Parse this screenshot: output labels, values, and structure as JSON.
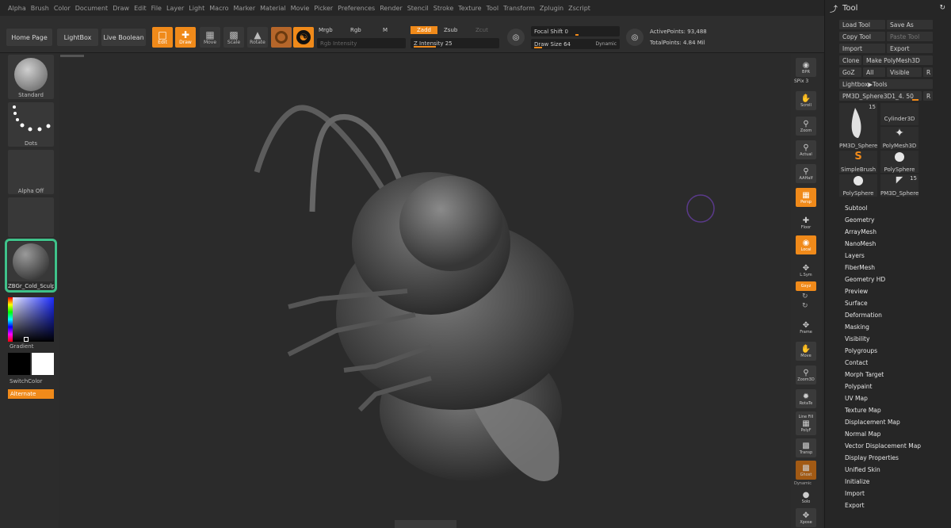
{
  "menu": [
    "Alpha",
    "Brush",
    "Color",
    "Document",
    "Draw",
    "Edit",
    "File",
    "Layer",
    "Light",
    "Macro",
    "Marker",
    "Material",
    "Movie",
    "Picker",
    "Preferences",
    "Render",
    "Stencil",
    "Stroke",
    "Texture",
    "Tool",
    "Transform",
    "Zplugin",
    "Zscript"
  ],
  "shelf": {
    "home_page": "Home Page",
    "lightbox": "LightBox",
    "live_boolean": "Live Boolean",
    "edit": "Edit",
    "draw": "Draw",
    "move": "Move",
    "scale": "Scale",
    "rotate": "Rotate",
    "mrgb": "Mrgb",
    "rgb": "Rgb",
    "m": "M",
    "rgb_intensity": "Rgb Intensity",
    "zadd": "Zadd",
    "zsub": "Zsub",
    "zcut": "Zcut",
    "z_intensity": "Z Intensity 25",
    "z_intensity_value": 25,
    "focal_shift": "Focal Shift 0",
    "draw_size": "Draw Size 64",
    "dynamic": "Dynamic",
    "active_points": "ActivePoints: 93,488",
    "total_points": "TotalPoints: 4.84 Mil"
  },
  "left": {
    "brush_label": "Standard",
    "stroke_label": "Dots",
    "alpha_label": "Alpha Off",
    "material_label": "ZBGr_Cold_Sculp",
    "gradient": "Gradient",
    "switch_color": "SwitchColor",
    "alternate": "Alternate"
  },
  "right": {
    "bpr": "BPR",
    "spix": "SPix 3",
    "scroll": "Scroll",
    "zoom": "Zoom",
    "actual": "Actual",
    "aahalf": "AAHalf",
    "persp": "Persp",
    "floor": "Floor",
    "local": "Local",
    "lsym": "L.Sym",
    "xyz": "Gxyz",
    "frame": "Frame",
    "move": "Move",
    "zoom3d": "Zoom3D",
    "rotate": "RotaTe",
    "line_fill": "Line Fill",
    "polyf": "PolyF",
    "transp": "Transp",
    "ghost": "Ghost",
    "dynamic": "Dynamic",
    "solo": "Solo",
    "xpose": "Xpose"
  },
  "tool": {
    "title": "Tool",
    "load_tool": "Load Tool",
    "save_as": "Save As",
    "copy_tool": "Copy Tool",
    "paste_tool": "Paste Tool",
    "import": "Import",
    "export": "Export",
    "clone": "Clone",
    "make_polymesh": "Make PolyMesh3D",
    "goz": "GoZ",
    "all": "All",
    "visible": "Visible",
    "r": "R",
    "lightbox_tools": "Lightbox▶Tools",
    "current_tool": "PM3D_Sphere3D1_4. 50",
    "tiles": [
      {
        "label": "PM3D_Sphere3D",
        "count": "15"
      },
      {
        "label": "Cylinder3D",
        "count": ""
      },
      {
        "label": "PolyMesh3D",
        "count": ""
      },
      {
        "label": "SimpleBrush",
        "count": ""
      },
      {
        "label": "PolySphere",
        "count": ""
      },
      {
        "label": "PolySphere",
        "count": ""
      },
      {
        "label": "PM3D_Sphere3D",
        "count": "15"
      }
    ],
    "subpalettes": [
      "Subtool",
      "Geometry",
      "ArrayMesh",
      "NanoMesh",
      "Layers",
      "FiberMesh",
      "Geometry HD",
      "Preview",
      "Surface",
      "Deformation",
      "Masking",
      "Visibility",
      "Polygroups",
      "Contact",
      "Morph Target",
      "Polypaint",
      "UV Map",
      "Texture Map",
      "Displacement Map",
      "Normal Map",
      "Vector Displacement Map",
      "Display Properties",
      "Unified Skin",
      "Initialize",
      "Import",
      "Export"
    ]
  },
  "colors": {
    "accent": "#f08a1a",
    "panel": "#2c2c2c",
    "highlight": "#3fc28a"
  }
}
